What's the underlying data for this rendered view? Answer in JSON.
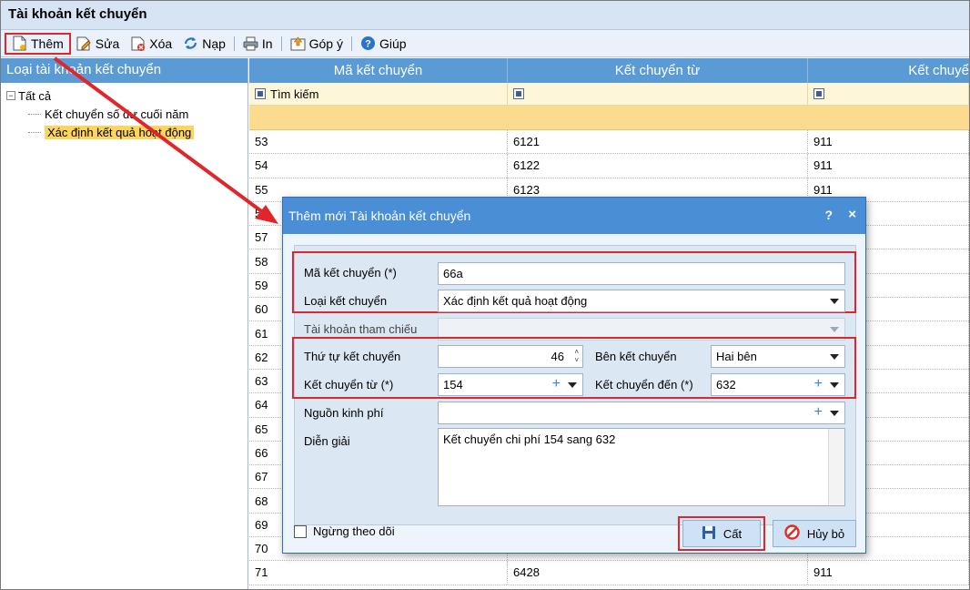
{
  "window": {
    "title": "Tài khoản kết chuyển"
  },
  "toolbar": [
    {
      "id": "add",
      "label": "Thêm"
    },
    {
      "id": "edit",
      "label": "Sửa"
    },
    {
      "id": "delete",
      "label": "Xóa"
    },
    {
      "id": "reload",
      "label": "Nạp"
    },
    {
      "id": "print",
      "label": "In"
    },
    {
      "id": "feedback",
      "label": "Góp ý"
    },
    {
      "id": "help",
      "label": "Giúp"
    }
  ],
  "left_panel": {
    "header": "Loại tài khoản kết chuyển",
    "root": "Tất cả",
    "children": [
      "Kết chuyển số dư cuối năm",
      "Xác định kết quả hoạt động"
    ]
  },
  "grid": {
    "columns": [
      "Mã kết chuyển",
      "Kết chuyển từ",
      "Kết chuyể"
    ],
    "filter_placeholder": "Tìm kiếm",
    "rows": [
      [
        "53",
        "6121",
        "911"
      ],
      [
        "54",
        "6122",
        "911"
      ],
      [
        "55",
        "6123",
        "911"
      ],
      [
        "56",
        "",
        ""
      ],
      [
        "57",
        "",
        ""
      ],
      [
        "58",
        "",
        ""
      ],
      [
        "59",
        "",
        ""
      ],
      [
        "60",
        "",
        ""
      ],
      [
        "61",
        "",
        ""
      ],
      [
        "62",
        "",
        ""
      ],
      [
        "63",
        "",
        ""
      ],
      [
        "64",
        "",
        ""
      ],
      [
        "65",
        "",
        ""
      ],
      [
        "66",
        "",
        ""
      ],
      [
        "67",
        "",
        ""
      ],
      [
        "68",
        "",
        ""
      ],
      [
        "69",
        "",
        ""
      ],
      [
        "70",
        "",
        ""
      ],
      [
        "71",
        "6428",
        "911"
      ]
    ]
  },
  "dialog": {
    "title": "Thêm mới Tài khoản kết chuyển",
    "help": "?",
    "close": "×",
    "code_label": "Mã kết chuyển (*)",
    "code_value": "66a",
    "type_label": "Loại kết chuyển",
    "type_value": "Xác định kết quả hoạt động",
    "ref_label": "Tài khoản tham chiếu",
    "ref_value": "",
    "order_label": "Thứ tự kết chuyển",
    "order_value": "46",
    "side_label": "Bên kết chuyển",
    "side_value": "Hai bên",
    "from_label": "Kết chuyển từ (*)",
    "from_value": "154",
    "to_label": "Kết chuyển đến (*)",
    "to_value": "632",
    "fund_label": "Nguồn kinh phí",
    "fund_value": "",
    "desc_label": "Diễn giải",
    "desc_value": "Kết chuyển chi phí 154 sang 632",
    "inactive_label": "Ngừng theo dõi",
    "save_label": "Cất",
    "cancel_label": "Hủy bỏ"
  },
  "colors": {
    "highlight": "#e0262b",
    "header": "#5b9bd5",
    "selected": "#fbd55f"
  }
}
